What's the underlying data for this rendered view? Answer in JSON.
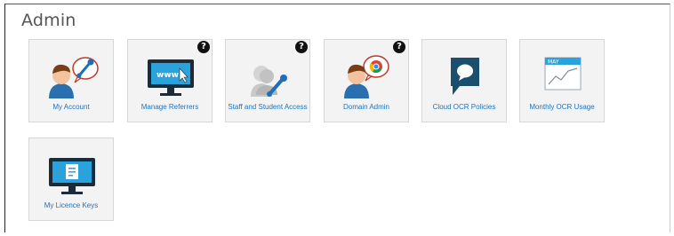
{
  "page": {
    "title": "Admin"
  },
  "tiles": [
    {
      "label": "My Account",
      "icon": "user-wrench-icon",
      "help": false
    },
    {
      "label": "Manage Referrers",
      "icon": "monitor-www-icon",
      "help": true
    },
    {
      "label": "Staff and Student Access",
      "icon": "users-wrench-icon",
      "help": true
    },
    {
      "label": "Domain Admin",
      "icon": "user-chrome-icon",
      "help": true
    },
    {
      "label": "Cloud OCR Policies",
      "icon": "speech-bubble-icon",
      "help": false
    },
    {
      "label": "Monthly OCR Usage",
      "icon": "calendar-chart-icon",
      "help": false
    },
    {
      "label": "My Licence Keys",
      "icon": "monitor-document-icon",
      "help": false
    }
  ],
  "help_glyph": "?",
  "colors": {
    "link": "#1e73be",
    "tile_bg": "#f3f3f3",
    "monitor": "#1b2b3a",
    "screen": "#2aa3dc",
    "wrench": "#1e6fb8"
  }
}
